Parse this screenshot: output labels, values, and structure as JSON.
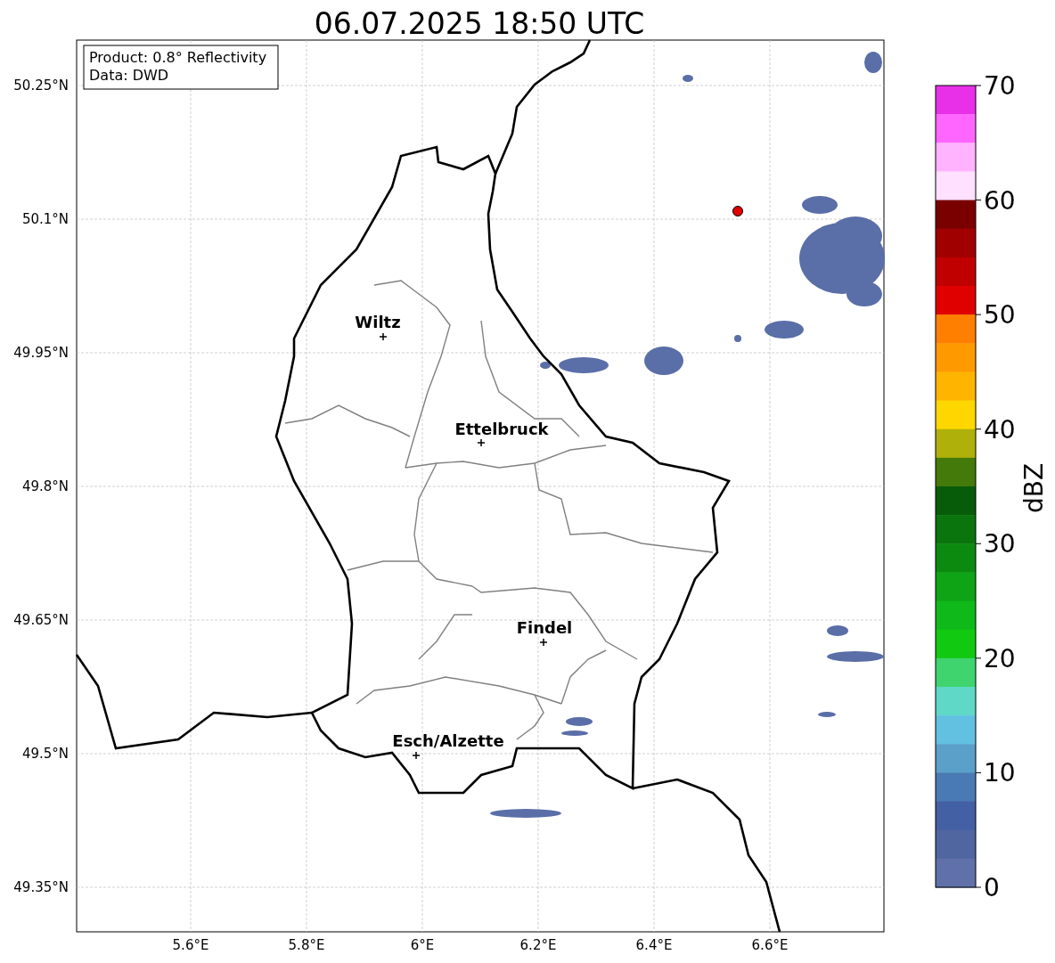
{
  "title": "06.07.2025 18:50 UTC",
  "info_box": [
    "Product: 0.8° Reflectivity",
    "Data: DWD"
  ],
  "lat_labels": [
    "50.25°N",
    "50.1°N",
    "49.95°N",
    "49.8°N",
    "49.65°N",
    "49.5°N",
    "49.35°N"
  ],
  "lon_labels": [
    "5.6°E",
    "5.8°E",
    "6°E",
    "6.2°E",
    "6.4°E",
    "6.6°E"
  ],
  "cities": [
    {
      "name": "Wiltz"
    },
    {
      "name": "Ettelbruck"
    },
    {
      "name": "Findel"
    },
    {
      "name": "Esch/Alzette"
    }
  ],
  "colorbar": {
    "label": "dBZ",
    "ticks": [
      "70",
      "60",
      "50",
      "40",
      "30",
      "20",
      "10",
      "0"
    ],
    "bins": [
      {
        "color": "#e830e8"
      },
      {
        "color": "#ff66ff"
      },
      {
        "color": "#ffb3ff"
      },
      {
        "color": "#ffe0ff"
      },
      {
        "color": "#7a0000"
      },
      {
        "color": "#a00000"
      },
      {
        "color": "#c00000"
      },
      {
        "color": "#e00000"
      },
      {
        "color": "#ff7f00"
      },
      {
        "color": "#ff9900"
      },
      {
        "color": "#ffb400"
      },
      {
        "color": "#ffd700"
      },
      {
        "color": "#b0b00a"
      },
      {
        "color": "#437a0a"
      },
      {
        "color": "#075c0a"
      },
      {
        "color": "#0a750c"
      },
      {
        "color": "#0c8a10"
      },
      {
        "color": "#0fa316"
      },
      {
        "color": "#10b91a"
      },
      {
        "color": "#12c912"
      },
      {
        "color": "#3fd46e"
      },
      {
        "color": "#60d8c8"
      },
      {
        "color": "#62c0e0"
      },
      {
        "color": "#5aa0c8"
      },
      {
        "color": "#4a7ab4"
      },
      {
        "color": "#4460a4"
      },
      {
        "color": "#5066a0"
      },
      {
        "color": "#6070a8"
      }
    ]
  }
}
